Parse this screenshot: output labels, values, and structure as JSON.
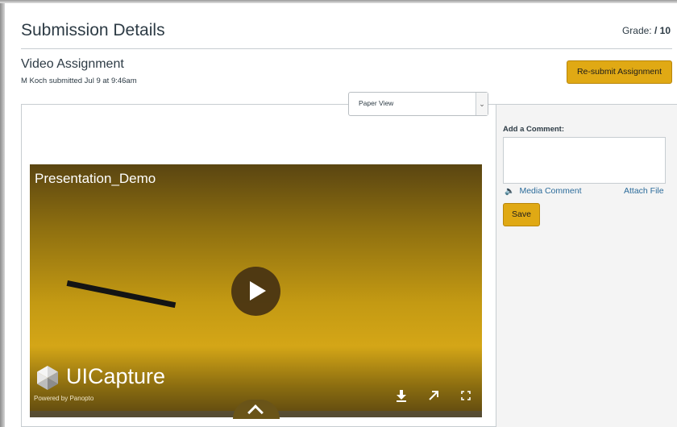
{
  "header": {
    "title": "Submission Details",
    "grade_label": "Grade:",
    "grade_value": "/ 10"
  },
  "assignment": {
    "title": "Video Assignment",
    "submitted_text": "M Koch submitted Jul 9 at 9:46am",
    "resubmit_label": "Re-submit Assignment"
  },
  "view_select": {
    "selected": "Paper View"
  },
  "video": {
    "title": "Presentation_Demo",
    "brand": "UICapture",
    "powered_by": "Powered by Panopto",
    "controls": {
      "download_icon": "download-icon",
      "popout_icon": "popout-icon",
      "fullscreen_icon": "fullscreen-icon",
      "play_icon": "play-icon",
      "expand_icon": "chevron-up-icon"
    }
  },
  "sidebar": {
    "comment_label": "Add a Comment:",
    "comment_value": "",
    "media_comment_label": "Media Comment",
    "attach_file_label": "Attach File",
    "save_label": "Save"
  },
  "colors": {
    "accent": "#e0a914",
    "link": "#2b6b9a",
    "text": "#2d3b45",
    "sidebar_bg": "#f4f4f4"
  }
}
